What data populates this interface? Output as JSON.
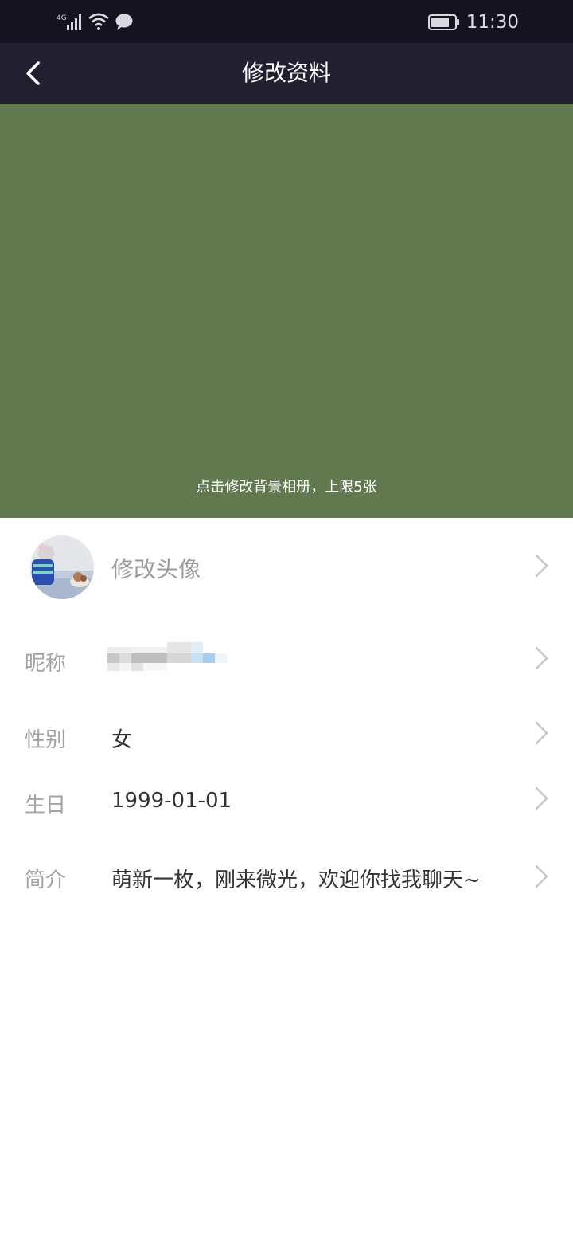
{
  "status_bar": {
    "network": "4G",
    "time": "11:30",
    "icons": [
      "signal-icon",
      "wifi-icon",
      "message-icon",
      "battery-icon"
    ]
  },
  "header": {
    "title": "修改资料",
    "back_icon": "chevron-left-icon"
  },
  "cover": {
    "color": "#62784f",
    "hint": "点击修改背景相册，上限5张"
  },
  "profile": {
    "avatar_label": "修改头像",
    "fields": [
      {
        "label": "昵称",
        "value": ""
      },
      {
        "label": "性别",
        "value": "女"
      },
      {
        "label": "生日",
        "value": "1999-01-01"
      },
      {
        "label": "简介",
        "value": "萌新一枚，刚来微光，欢迎你找我聊天~"
      }
    ]
  },
  "colors": {
    "status_bg": "#15131f",
    "nav_bg": "#211f30",
    "label": "#a3a3a3",
    "value": "#333333",
    "chevron": "#c8c8c8"
  }
}
